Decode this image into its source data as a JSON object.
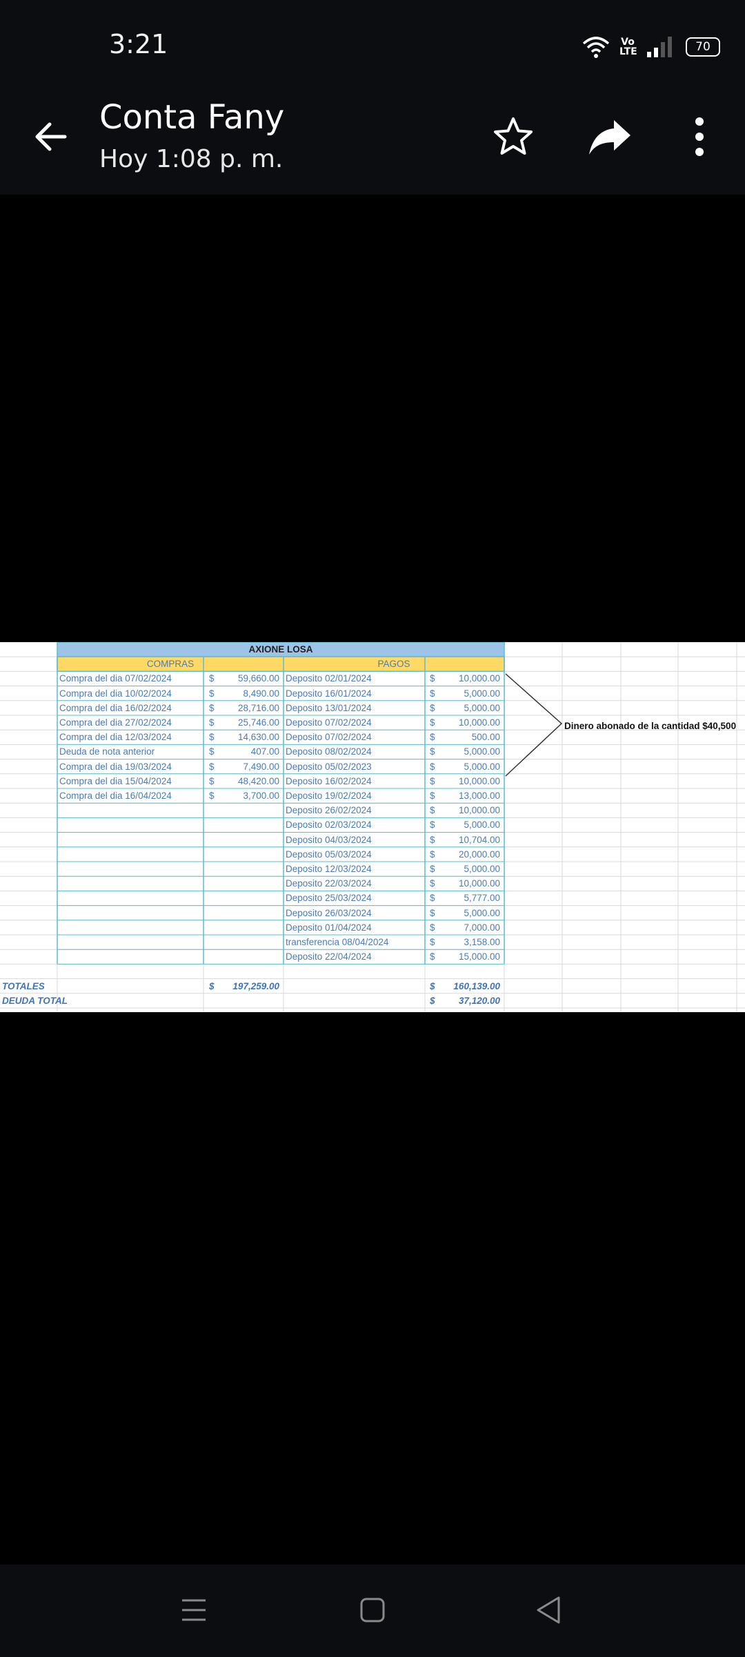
{
  "status": {
    "time": "3:21",
    "network": "Vo LTE",
    "battery": "70"
  },
  "header": {
    "title": "Conta Fany",
    "subtitle": "Hoy 1:08 p. m."
  },
  "icons": {
    "back": "arrow-left-icon",
    "star": "star-outline-icon",
    "share": "share-icon",
    "more": "more-vertical-icon"
  },
  "sheet": {
    "title": "AXIONE LOSA",
    "compras_header": "COMPRAS",
    "pagos_header": "PAGOS",
    "compras": [
      {
        "desc": "Compra del dia 07/02/2024",
        "cur": "$",
        "amount": "59,660.00"
      },
      {
        "desc": "Compra del dia 10/02/2024",
        "cur": "$",
        "amount": "8,490.00"
      },
      {
        "desc": "Compra del dia 16/02/2024",
        "cur": "$",
        "amount": "28,716.00"
      },
      {
        "desc": "Compra del dia 27/02/2024",
        "cur": "$",
        "amount": "25,746.00"
      },
      {
        "desc": "Compra del dia 12/03/2024",
        "cur": "$",
        "amount": "14,630.00"
      },
      {
        "desc": "Deuda de nota anterior",
        "cur": "$",
        "amount": "407.00"
      },
      {
        "desc": "Compra del dia 19/03/2024",
        "cur": "$",
        "amount": "7,490.00"
      },
      {
        "desc": "Compra del dia 15/04/2024",
        "cur": "$",
        "amount": "48,420.00"
      },
      {
        "desc": "Compra del dia 16/04/2024",
        "cur": "$",
        "amount": "3,700.00"
      }
    ],
    "pagos": [
      {
        "desc": "Deposito 02/01/2024",
        "cur": "$",
        "amount": "10,000.00"
      },
      {
        "desc": "Deposito 16/01/2024",
        "cur": "$",
        "amount": "5,000.00"
      },
      {
        "desc": "Deposito 13/01/2024",
        "cur": "$",
        "amount": "5,000.00"
      },
      {
        "desc": "Deposito 07/02/2024",
        "cur": "$",
        "amount": "10,000.00"
      },
      {
        "desc": "Deposito 07/02/2024",
        "cur": "$",
        "amount": "500.00"
      },
      {
        "desc": "Deposito 08/02/2024",
        "cur": "$",
        "amount": "5,000.00"
      },
      {
        "desc": "Deposito 05/02/2023",
        "cur": "$",
        "amount": "5,000.00"
      },
      {
        "desc": "Deposito 16/02/2024",
        "cur": "$",
        "amount": "10,000.00"
      },
      {
        "desc": "Deposito 19/02/2024",
        "cur": "$",
        "amount": "13,000.00"
      },
      {
        "desc": "Deposito 26/02/2024",
        "cur": "$",
        "amount": "10,000.00"
      },
      {
        "desc": "Deposito 02/03/2024",
        "cur": "$",
        "amount": "5,000.00"
      },
      {
        "desc": "Deposito 04/03/2024",
        "cur": "$",
        "amount": "10,704.00"
      },
      {
        "desc": "Deposito 05/03/2024",
        "cur": "$",
        "amount": "20,000.00"
      },
      {
        "desc": "Deposito 12/03/2024",
        "cur": "$",
        "amount": "5,000.00"
      },
      {
        "desc": "Deposito 22/03/2024",
        "cur": "$",
        "amount": "10,000.00"
      },
      {
        "desc": "Deposito 25/03/2024",
        "cur": "$",
        "amount": "5,777.00"
      },
      {
        "desc": "Deposito 26/03/2024",
        "cur": "$",
        "amount": "5,000.00"
      },
      {
        "desc": "Deposito 01/04/2024",
        "cur": "$",
        "amount": "7,000.00"
      },
      {
        "desc": "transferencia  08/04/2024",
        "cur": "$",
        "amount": "3,158.00"
      },
      {
        "desc": "Deposito 22/04/2024",
        "cur": "$",
        "amount": "15,000.00"
      }
    ],
    "totales_label": "TOTALES",
    "totales_compras_cur": "$",
    "totales_compras": "197,259.00",
    "totales_pagos_cur": "$",
    "totales_pagos": "160,139.00",
    "deuda_label": "DEUDA TOTAL",
    "deuda_cur": "$",
    "deuda": "37,120.00",
    "note": "Dinero abonado de la cantidad $40,500"
  },
  "colors": {
    "title_bg": "#9dc3e6",
    "header_bg": "#ffd966",
    "grid": "#d9d9d9",
    "table_border": "#5bbcd2",
    "text_blue": "#4a7bb5",
    "totals_blue": "#3f74b8"
  }
}
